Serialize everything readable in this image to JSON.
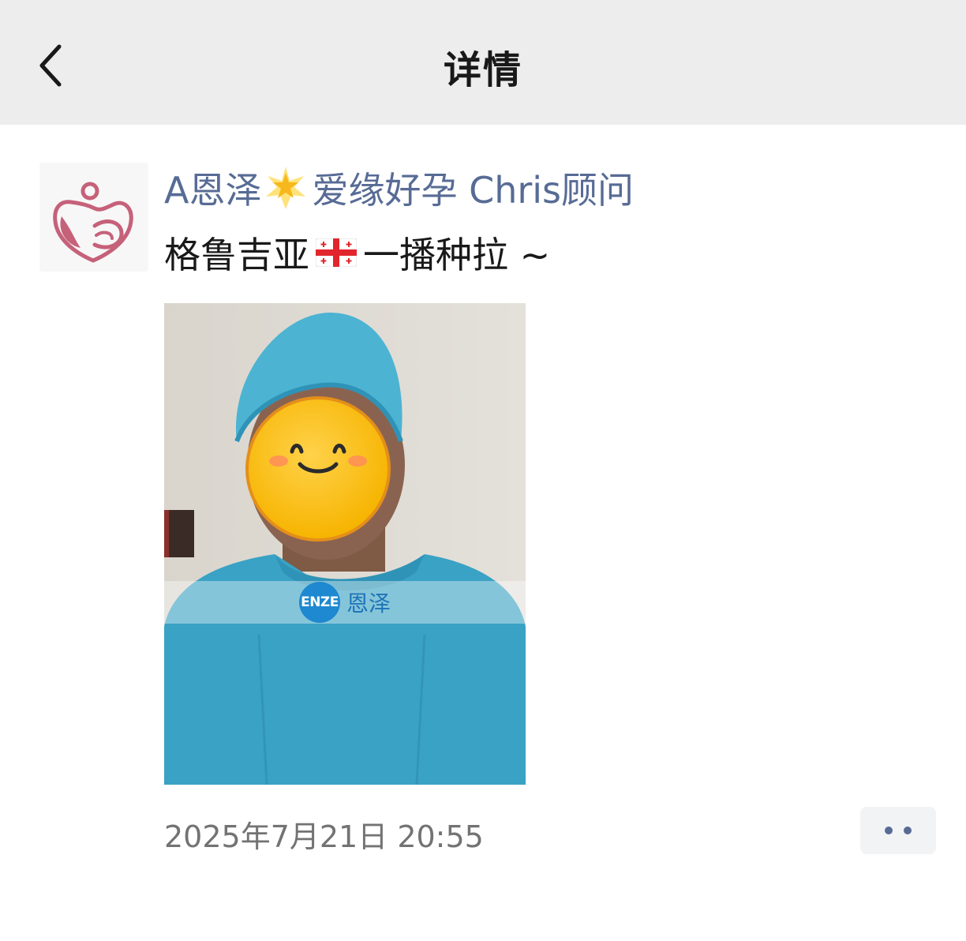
{
  "navbar": {
    "title": "详情",
    "back_icon": "chevron-left-icon"
  },
  "post": {
    "avatar_icon": "hands-heart-logo-icon",
    "author": {
      "name_prefix": "A恩泽",
      "emoji": "glowing-star-icon",
      "name_suffix": "爱缘好孕 Chris顾问"
    },
    "text": {
      "before_flag": "格鲁吉亚",
      "flag": "georgia-flag-icon",
      "after_flag": "一播种拉 ~"
    },
    "image": {
      "watermark_badge": "ENZE",
      "watermark_text": "恩泽",
      "face_cover": "smiley-face-icon"
    },
    "timestamp": "2025年7月21日 20:55",
    "more_icon": "more-dots-icon"
  },
  "colors": {
    "navbar_bg": "#ededed",
    "author_link": "#576b95",
    "text": "#191919",
    "timestamp": "#737373"
  }
}
